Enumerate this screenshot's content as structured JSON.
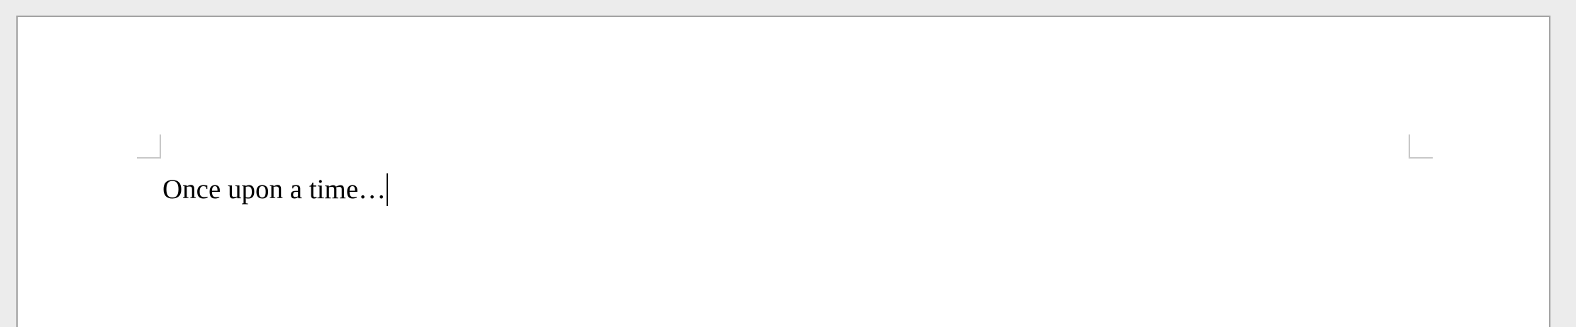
{
  "document": {
    "body_text": "Once upon a time…"
  }
}
